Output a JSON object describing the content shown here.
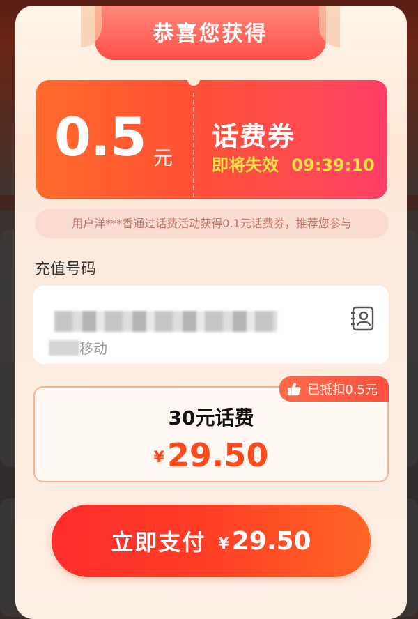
{
  "modal": {
    "title": "恭喜您获得"
  },
  "coupon": {
    "amount": "0.5",
    "unit": "元",
    "name": "话费券",
    "expire_label": "即将失效",
    "countdown": "09:39:10"
  },
  "notice": {
    "text": "用户洋***香通过话费活动获得0.1元话费券，推荐您参与"
  },
  "recharge": {
    "label": "充值号码",
    "carrier": "移动",
    "contacts_icon": "contacts-book-icon"
  },
  "product": {
    "deduct_badge": "已抵扣0.5元",
    "badge_icon": "thumbs-up-icon",
    "name": "30元话费",
    "currency": "¥",
    "price": "29.50"
  },
  "pay": {
    "label": "立即支付",
    "currency": "¥",
    "amount": "29.50"
  },
  "colors": {
    "accent_red": "#ff3b3b",
    "accent_orange": "#ff6a2b",
    "price_orange": "#ff4a1c",
    "expire_yellow": "#ffe24a"
  }
}
